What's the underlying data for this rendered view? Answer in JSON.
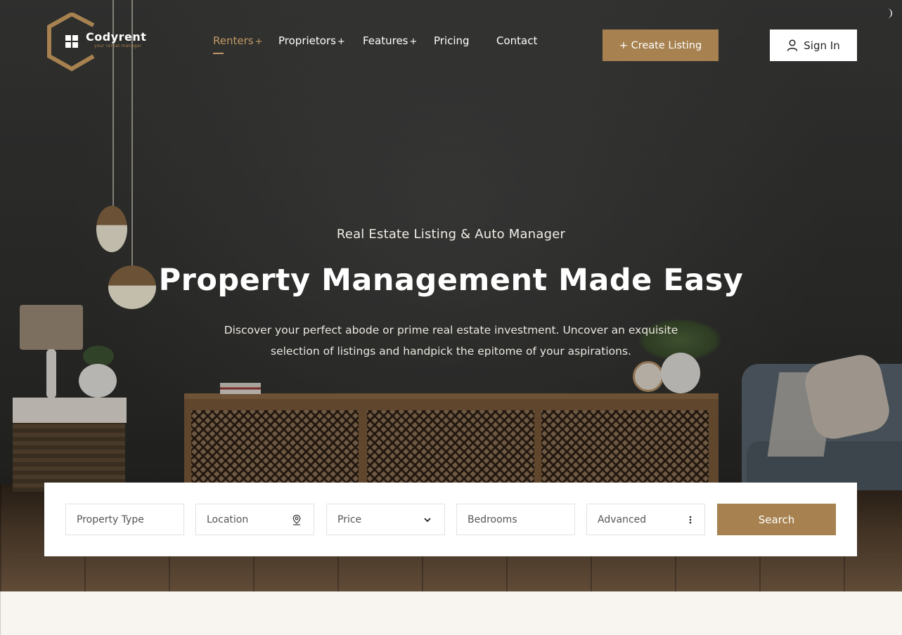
{
  "brand": {
    "name": "Codyrent",
    "tagline": "your rental manager",
    "accent_color": "#a7814f"
  },
  "nav": {
    "items": [
      {
        "label": "Renters",
        "suffix": "+",
        "active": true
      },
      {
        "label": "Proprietors",
        "suffix": "+",
        "active": false
      },
      {
        "label": "Features",
        "suffix": "+",
        "active": false
      },
      {
        "label": "Pricing",
        "suffix": "",
        "active": false
      },
      {
        "label": "Contact",
        "suffix": "",
        "active": false
      }
    ]
  },
  "header": {
    "create_listing_label": "+ Create Listing",
    "sign_in_label": "Sign In",
    "sign_in_icon": "user-icon",
    "theme_toggle_icon": "moon-icon"
  },
  "hero": {
    "eyebrow": "Real Estate Listing & Auto Manager",
    "headline": "Property Management Made Easy",
    "lede": "Discover your perfect abode or prime real estate investment. Uncover an exquisite selection of listings and handpick the epitome of your aspirations."
  },
  "search": {
    "property_type": "Property Type",
    "location": "Location",
    "location_icon": "location-pin-icon",
    "price": "Price",
    "price_icon": "chevron-down-icon",
    "bedrooms": "Bedrooms",
    "advanced": "Advanced",
    "advanced_icon": "vertical-dots-icon",
    "search_label": "Search"
  }
}
